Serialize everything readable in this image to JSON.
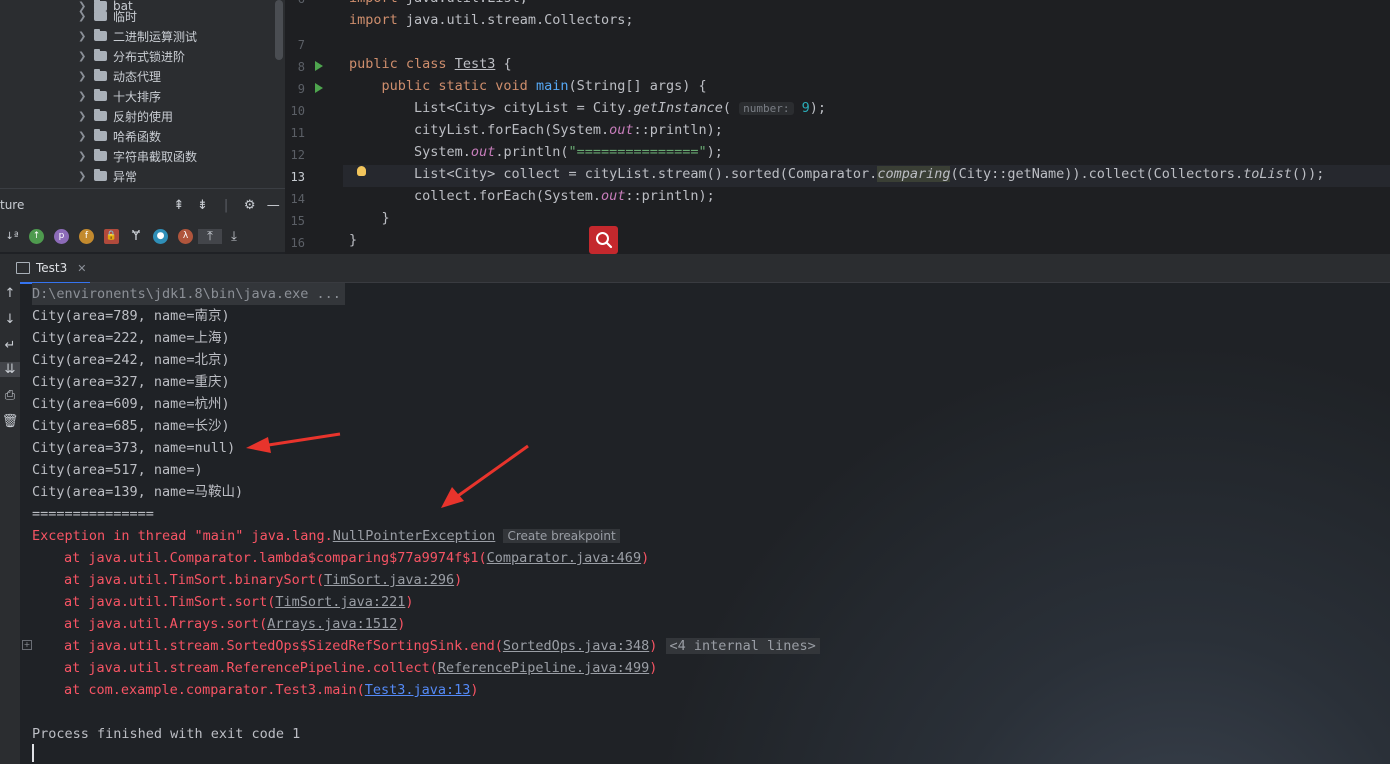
{
  "tree": {
    "items": [
      {
        "label": "临时"
      },
      {
        "label": "二进制运算测试"
      },
      {
        "label": "分布式锁进阶"
      },
      {
        "label": "动态代理"
      },
      {
        "label": "十大排序"
      },
      {
        "label": "反射的使用"
      },
      {
        "label": "哈希函数"
      },
      {
        "label": "字符串截取函数"
      },
      {
        "label": "异常"
      }
    ]
  },
  "structure": {
    "label": "ture"
  },
  "editor": {
    "line_numbers": [
      "6",
      "7",
      "8",
      "9",
      "10",
      "11",
      "12",
      "13",
      "14",
      "15",
      "16"
    ],
    "active_line": "13",
    "hint_number": "number:"
  },
  "run": {
    "tab_label": "Test3",
    "console": [
      "D:\\environents\\jdk1.8\\bin\\java.exe ...",
      "City(area=789, name=南京)",
      "City(area=222, name=上海)",
      "City(area=242, name=北京)",
      "City(area=327, name=重庆)",
      "City(area=609, name=杭州)",
      "City(area=685, name=长沙)",
      "City(area=373, name=null)",
      "City(area=517, name=)",
      "City(area=139, name=马鞍山)",
      "==============="
    ],
    "exception": {
      "prefix": "Exception in thread \"main\" java.lang.",
      "type": "NullPointerException",
      "create_breakpoint": "Create breakpoint"
    },
    "stack": [
      {
        "text": "at java.util.Comparator.lambda$comparing$77a9974f$1(",
        "link": "Comparator.java:469",
        "suffix": ")"
      },
      {
        "text": "at java.util.TimSort.binarySort(",
        "link": "TimSort.java:296",
        "suffix": ")"
      },
      {
        "text": "at java.util.TimSort.sort(",
        "link": "TimSort.java:221",
        "suffix": ")"
      },
      {
        "text": "at java.util.Arrays.sort(",
        "link": "Arrays.java:1512",
        "suffix": ")"
      },
      {
        "text": "at java.util.stream.SortedOps$SizedRefSortingSink.end(",
        "link": "SortedOps.java:348",
        "suffix": ")",
        "badge": "<4 internal lines>"
      },
      {
        "text": "at java.util.stream.ReferencePipeline.collect(",
        "link": "ReferencePipeline.java:499",
        "suffix": ")"
      },
      {
        "text": "at com.example.comparator.Test3.main(",
        "link": "Test3.java:13",
        "suffix": ")"
      }
    ],
    "exit_message": "Process finished with exit code 1"
  },
  "colors": {
    "error": "#f75464",
    "keyword": "#cf8e6d",
    "link_blue": "#548af7",
    "annotation_arrow": "#e8342c"
  }
}
